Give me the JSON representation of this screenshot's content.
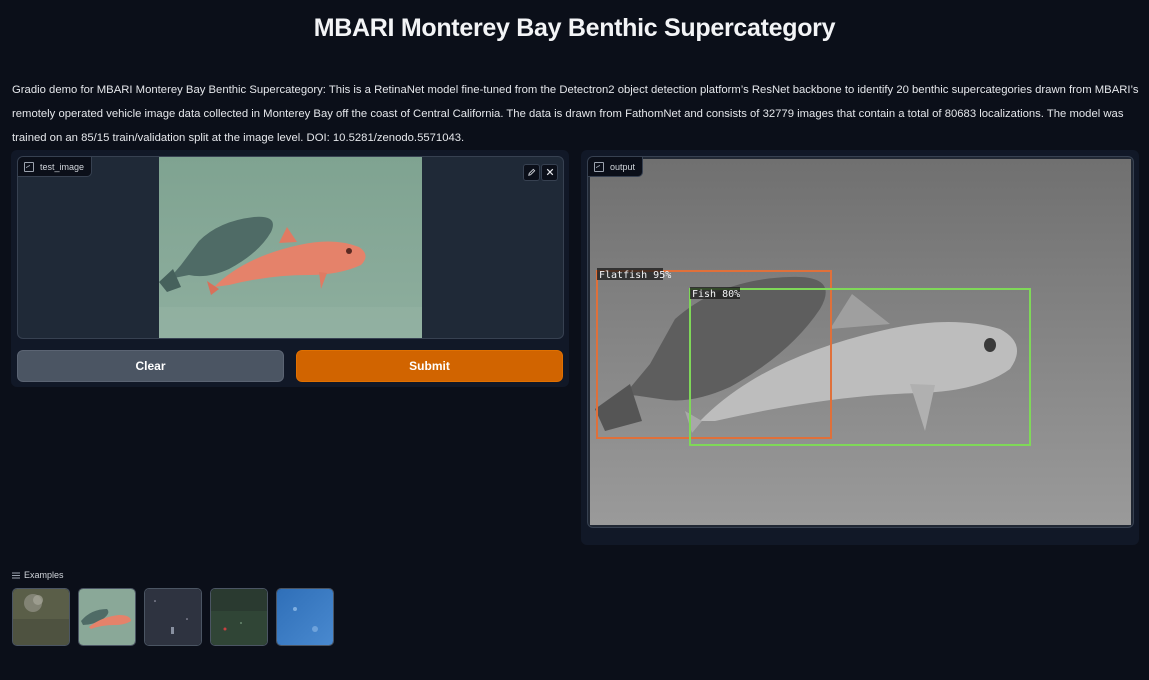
{
  "page": {
    "title": "MBARI Monterey Bay Benthic Supercategory",
    "description": "Gradio demo for MBARI Monterey Bay Benthic Supercategory: This is a RetinaNet model fine-tuned from the Detectron2 object detection platform’s ResNet backbone to identify 20 benthic supercategories drawn from MBARI’s remotely operated vehicle image data collected in Monterey Bay off the coast of Central California. The data is drawn from FathomNet and consists of 32779 images that contain a total of 80683 localizations. The model was trained on an 85/15 train/validation split at the image level. DOI: 10.5281/zenodo.5571043."
  },
  "input": {
    "label": "test_image",
    "icon": "image-icon",
    "edit_icon": "pencil-icon",
    "close_icon": "close-icon"
  },
  "buttons": {
    "clear": "Clear",
    "submit": "Submit"
  },
  "output": {
    "label": "output",
    "icon": "image-icon",
    "detections": [
      {
        "label": "Flatfish 95%",
        "color": "#e0703a"
      },
      {
        "label": "Fish 80%",
        "color": "#7fd858"
      }
    ]
  },
  "examples": {
    "label": "Examples",
    "icon": "list-icon",
    "count": 5
  },
  "colors": {
    "background": "#0b0f19",
    "panel": "#111827",
    "submit": "#d16400",
    "clear": "#4b5563"
  }
}
